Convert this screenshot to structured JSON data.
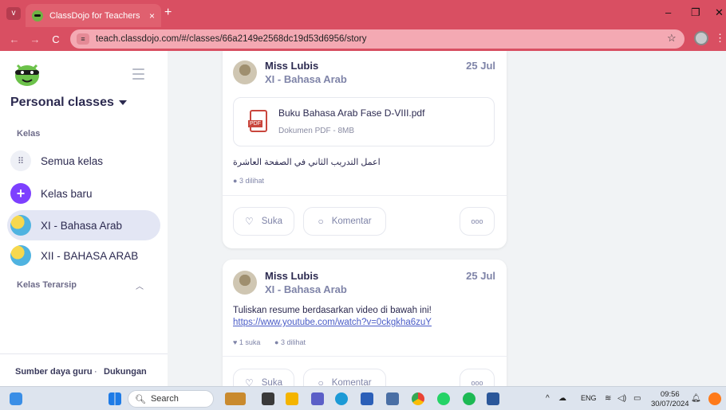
{
  "browser": {
    "tab_title": "ClassDojo for Teachers",
    "tab_close": "×",
    "new_tab": "+",
    "url": "teach.classdojo.com/#/classes/66a2149e2568dc19d53d6956/story",
    "back": "←",
    "forward": "→",
    "reload": "C",
    "bookmark": "☆",
    "menu": "⋮",
    "minimize": "–",
    "restore": "❐",
    "close": "✕",
    "tab_menu": "v"
  },
  "sidebar": {
    "title": "Personal classes",
    "section_kelas": "Kelas",
    "items": [
      {
        "label": "Semua kelas",
        "icon": "grid-icon"
      },
      {
        "label": "Kelas baru",
        "icon": "plus-icon"
      },
      {
        "label": "XI - Bahasa Arab",
        "icon": "globe-icon",
        "active": true
      },
      {
        "label": "XII - BAHASA ARAB",
        "icon": "globe-icon"
      }
    ],
    "section_archived": "Kelas Terarsip",
    "footer_resources": "Sumber daya guru",
    "footer_sep": "·",
    "footer_support": "Dukungan"
  },
  "posts": [
    {
      "author": "Miss Lubis",
      "class": "XI - Bahasa Arab",
      "date": "25 Jul",
      "attachment": {
        "name": "Buku Bahasa Arab Fase D-VIII.pdf",
        "meta": "Dokumen PDF - 8MB",
        "icon_label": "PDF"
      },
      "text": "اعمل التدريب الثاني في الصفحة العاشرة",
      "views": "3 dilihat",
      "like_label": "Suka",
      "comment_label": "Komentar"
    },
    {
      "author": "Miss Lubis",
      "class": "XI - Bahasa Arab",
      "date": "25 Jul",
      "text": "Tuliskan resume berdasarkan video di bawah ini!",
      "link": "https://www.youtube.com/watch?v=0ckgkha6zuY",
      "likes": "1 suka",
      "views": "3 dilihat",
      "like_label": "Suka",
      "comment_label": "Komentar"
    }
  ],
  "taskbar": {
    "search_placeholder": "Search",
    "lang": "ENG",
    "time": "09:56",
    "date": "30/07/2024"
  },
  "colors": {
    "chrome": "#d94f62",
    "accent_purple": "#7d40ff",
    "active_item": "#e3e6f4"
  }
}
